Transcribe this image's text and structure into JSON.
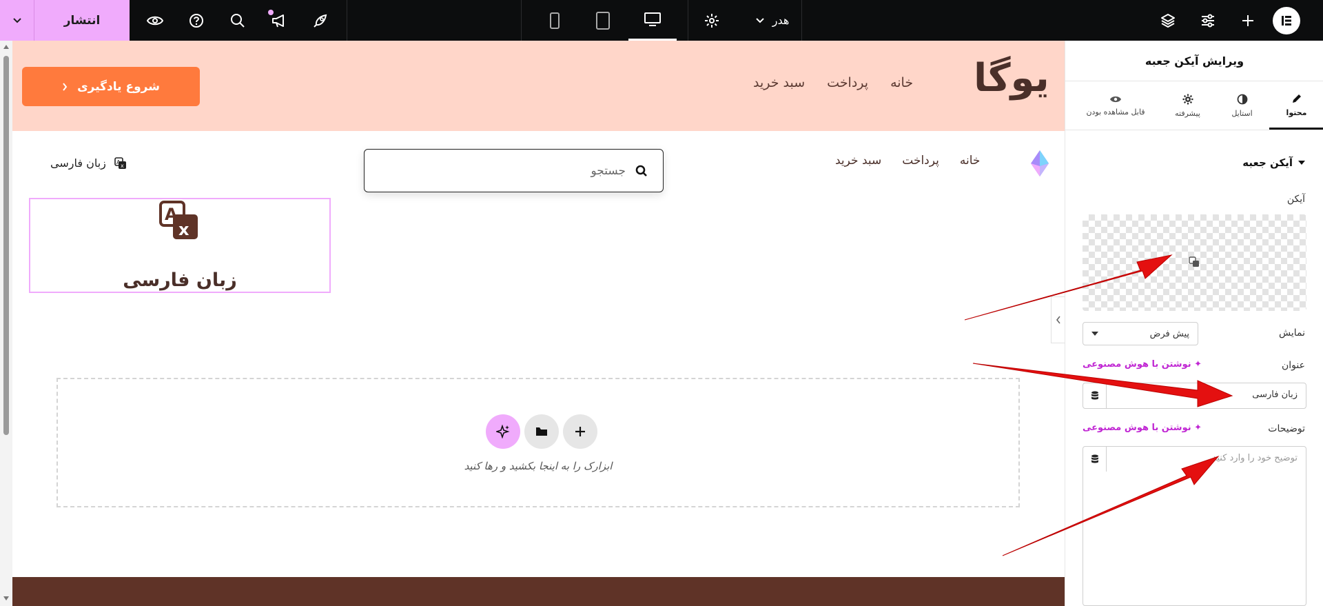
{
  "topbar": {
    "publish_label": "انتشار",
    "header_label": "هدر",
    "icons": [
      "chevron-down-icon",
      "eye-icon",
      "help-icon",
      "search-icon",
      "megaphone-icon",
      "rocket-icon",
      "mobile-icon",
      "tablet-icon",
      "desktop-icon",
      "gear-icon",
      "layers-icon",
      "sliders-icon",
      "plus-icon",
      "elementor-logo"
    ]
  },
  "hero": {
    "brand": "یوگا",
    "nav": [
      "خانه",
      "پرداخت",
      "سبد خرید"
    ],
    "cta_label": "شروع یادگیری"
  },
  "header2": {
    "nav": [
      "خانه",
      "پرداخت",
      "سبد خرید"
    ],
    "search_placeholder": "جستجو",
    "lang_label": "زبان فارسی"
  },
  "iconbox": {
    "title": "زبان فارسی"
  },
  "dropzone": {
    "text": "ابزارک را به اینجا بکشید و رها کنید"
  },
  "panel": {
    "title": "ویرایش آیکن جعبه",
    "tabs": [
      {
        "label": "محتوا",
        "icon": "pencil-icon",
        "active": true
      },
      {
        "label": "استایل",
        "icon": "contrast-icon",
        "active": false
      },
      {
        "label": "پیشرفته",
        "icon": "gear-icon",
        "active": false
      },
      {
        "label": "قابل مشاهده بودن",
        "icon": "eye-icon",
        "active": false
      }
    ],
    "section": "آیکن جعبه",
    "icon_label": "آیکن",
    "display_label": "نمایش",
    "display_value": "پیش فرض",
    "title_label": "عنوان",
    "title_value": "زبان فارسی",
    "ai_link": "نوشتن با هوش مصنوعی",
    "desc_label": "توضیحات",
    "desc_placeholder": "توضیح خود را وارد کنید"
  },
  "colors": {
    "accent": "#f0abfc",
    "hero_bg": "#ffd6c9",
    "cta": "#ff7a3d",
    "brown": "#4a2f29",
    "footer": "#5f3327",
    "arrow": "#ee1111"
  }
}
